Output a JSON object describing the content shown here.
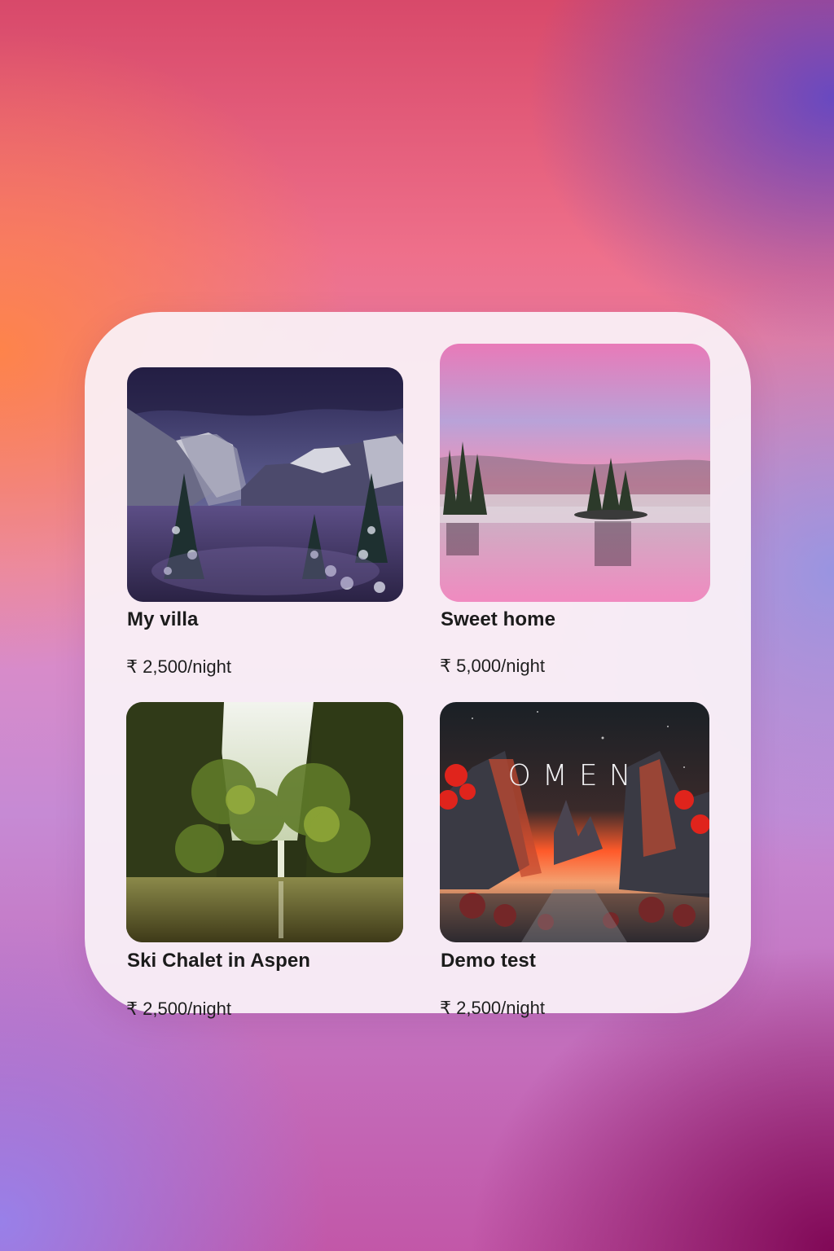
{
  "listings": [
    {
      "title": "My villa",
      "price": "₹ 2,500/night",
      "image": "snowy-mountain-valley-photo"
    },
    {
      "title": "Sweet home",
      "price": "₹ 5,000/night",
      "image": "misty-lake-sunset-photo"
    },
    {
      "title": "Ski Chalet in Aspen",
      "price": "₹ 2,500/night",
      "image": "forest-waterfall-photo"
    },
    {
      "title": "Demo test",
      "price": "₹ 2,500/night",
      "image": "omen-red-canyon-artwork",
      "image_text": "OMEN"
    }
  ],
  "colors": {
    "card_background": "#faf2f8",
    "text": "#1b1b1b"
  }
}
